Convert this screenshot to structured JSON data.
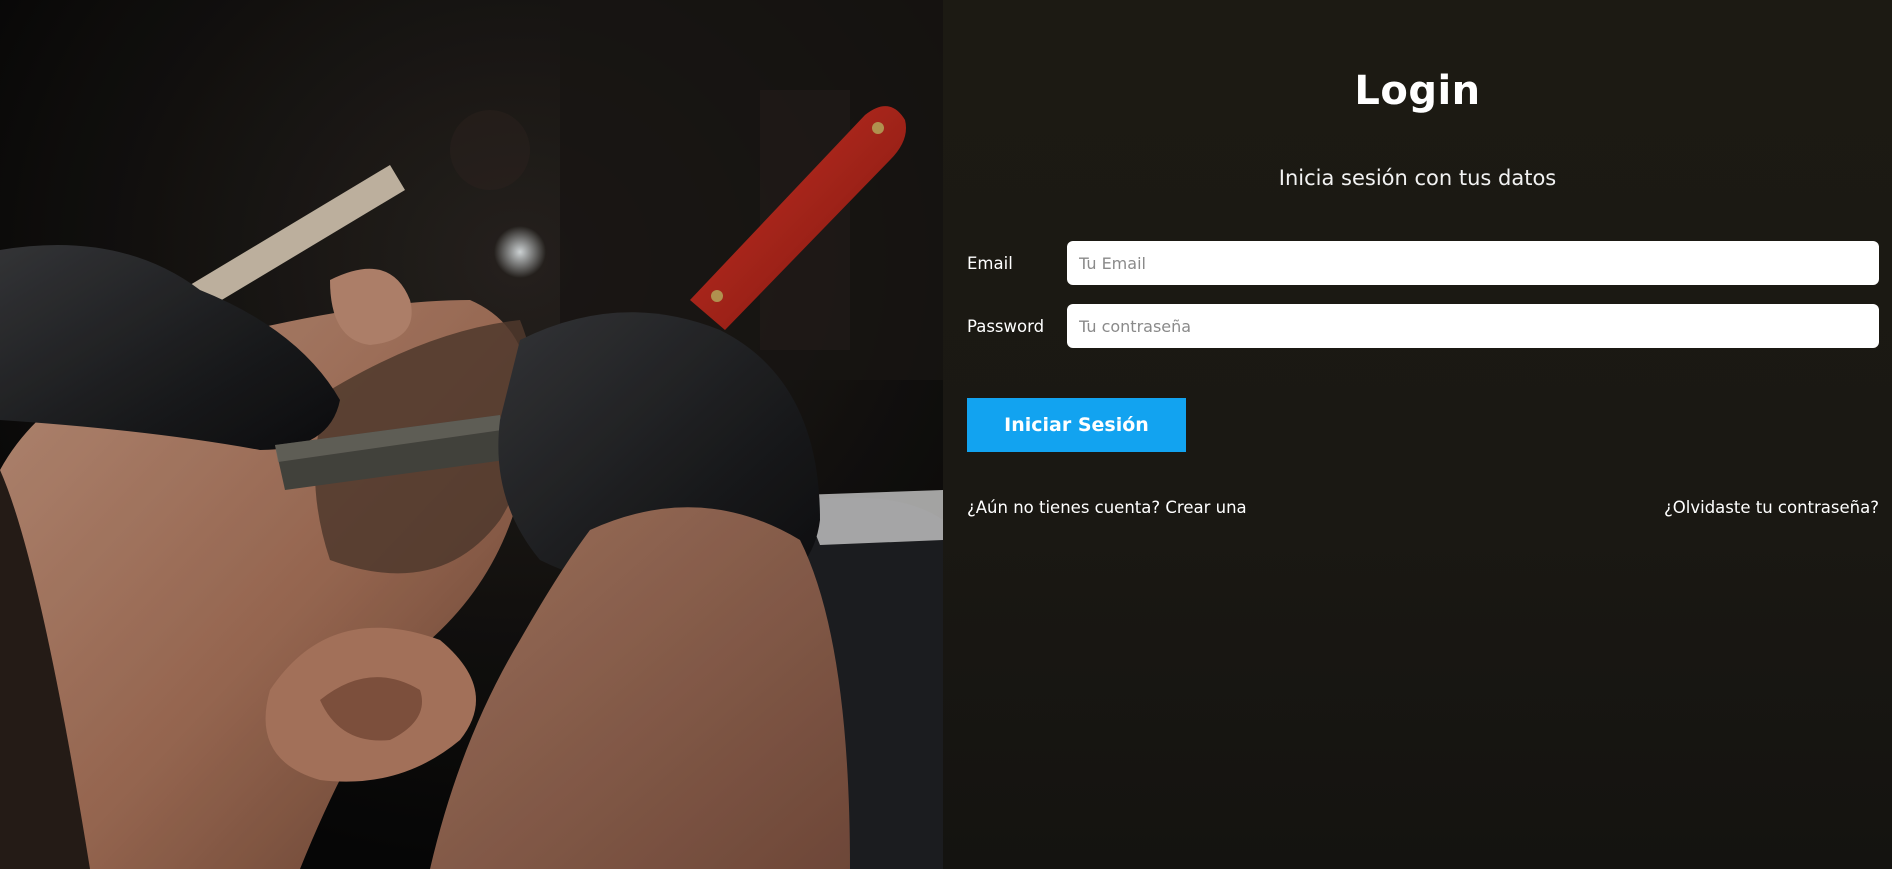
{
  "login": {
    "title": "Login",
    "subtitle": "Inicia sesión con tus datos",
    "email": {
      "label": "Email",
      "placeholder": "Tu Email",
      "value": ""
    },
    "password": {
      "label": "Password",
      "placeholder": "Tu contraseña",
      "value": ""
    },
    "submit_label": "Iniciar Sesión",
    "signup_link": "¿Aún no tienes cuenta? Crear una",
    "forgot_link": "¿Olvidaste tu contraseña?"
  },
  "colors": {
    "panel_background": "#1b1912",
    "button_accent": "#12a3f0",
    "text": "#ffffff",
    "input_background": "#ffffff"
  },
  "hero_image": {
    "subject": "barber-shaving-with-straight-razor",
    "icons": [
      "straight-razor",
      "gloved-hands"
    ]
  }
}
